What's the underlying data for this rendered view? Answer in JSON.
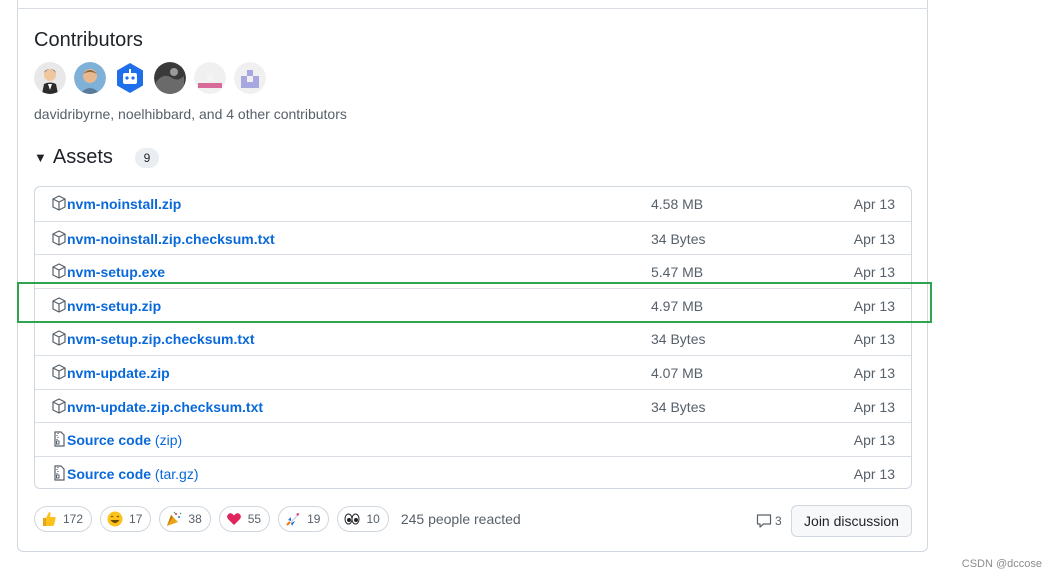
{
  "contributors": {
    "title": "Contributors",
    "summary": "davidribyrne, noelhibbard, and 4 other contributors",
    "avatars": [
      "cartoon-man",
      "photo-man",
      "bot",
      "dark-photo",
      "pink-identicon",
      "lavender-identicon"
    ]
  },
  "assets": {
    "title": "Assets",
    "count": "9",
    "items": [
      {
        "name": "nvm-noinstall.zip",
        "sub": "",
        "size": "4.58 MB",
        "date": "Apr 13",
        "icon": "package-icon"
      },
      {
        "name": "nvm-noinstall.zip.checksum.txt",
        "sub": "",
        "size": "34 Bytes",
        "date": "Apr 13",
        "icon": "package-icon"
      },
      {
        "name": "nvm-setup.exe",
        "sub": "",
        "size": "5.47 MB",
        "date": "Apr 13",
        "icon": "package-icon"
      },
      {
        "name": "nvm-setup.zip",
        "sub": "",
        "size": "4.97 MB",
        "date": "Apr 13",
        "icon": "package-icon"
      },
      {
        "name": "nvm-setup.zip.checksum.txt",
        "sub": "",
        "size": "34 Bytes",
        "date": "Apr 13",
        "icon": "package-icon"
      },
      {
        "name": "nvm-update.zip",
        "sub": "",
        "size": "4.07 MB",
        "date": "Apr 13",
        "icon": "package-icon"
      },
      {
        "name": "nvm-update.zip.checksum.txt",
        "sub": "",
        "size": "34 Bytes",
        "date": "Apr 13",
        "icon": "package-icon"
      },
      {
        "name": "Source code",
        "sub": " (zip)",
        "size": "",
        "date": "Apr 13",
        "icon": "file-zip-icon"
      },
      {
        "name": "Source code",
        "sub": " (tar.gz)",
        "size": "",
        "date": "Apr 13",
        "icon": "file-zip-icon"
      }
    ]
  },
  "reactions": {
    "items": [
      {
        "emoji": "thumbs-up",
        "count": "172"
      },
      {
        "emoji": "laugh",
        "count": "17"
      },
      {
        "emoji": "hooray",
        "count": "38"
      },
      {
        "emoji": "heart",
        "count": "55"
      },
      {
        "emoji": "rocket",
        "count": "19"
      },
      {
        "emoji": "eyes",
        "count": "10"
      }
    ],
    "summary": "245 people reacted"
  },
  "discussion": {
    "comment_count": "3",
    "join_label": "Join discussion"
  },
  "watermark": "CSDN @dccose",
  "colors": {
    "link": "#0969da",
    "highlight": "#2ea44f",
    "border": "#d0d7de"
  }
}
